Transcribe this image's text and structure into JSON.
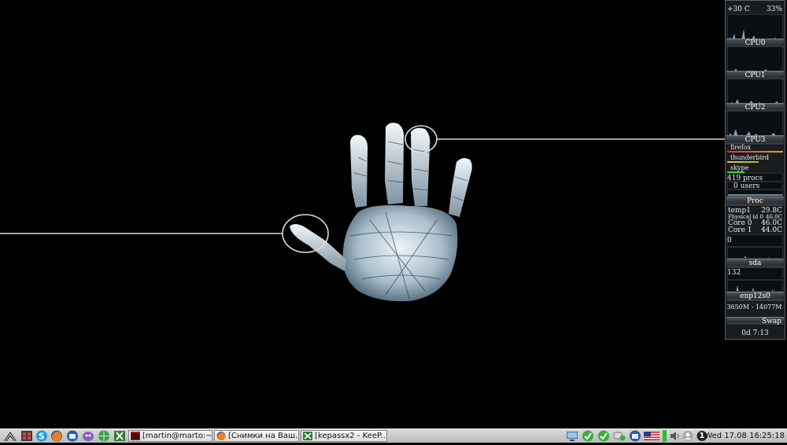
{
  "monitor": {
    "temp_label": "+30 C",
    "temp_percent": "33%",
    "cpus": [
      {
        "label": "CPU0",
        "value": "0%"
      },
      {
        "label": "CPU1",
        "value": "3%"
      },
      {
        "label": "CPU2",
        "value": "4%"
      },
      {
        "label": "CPU3",
        "value": ""
      }
    ],
    "top_procs": [
      {
        "name": "firefox",
        "color": "#e83030"
      },
      {
        "name": "thunderbird",
        "color": "#e8d020"
      },
      {
        "name": "skype",
        "color": "#30d040"
      }
    ],
    "procs_count": "419 procs",
    "users_count": "0 users",
    "proc_label": "Proc",
    "sensors": [
      {
        "name": "temp1",
        "value": "29.8C"
      },
      {
        "name": "Physical id 0",
        "value": "46.0C"
      },
      {
        "name": "Core 0",
        "value": "46.0C"
      },
      {
        "name": "Core 1",
        "value": "44.0C"
      }
    ],
    "disk_value": "0",
    "disk_label": "sda",
    "net_value": "132",
    "net_label": "enp12s0",
    "mem_text": "3650M - 14077M",
    "swap_label": "Swap",
    "uptime": "0d  7:13"
  },
  "taskbar": {
    "tasks": [
      {
        "label": "[martin@marto:~]",
        "icon": "terminal-icon"
      },
      {
        "label": "[Снимки на Ваш...",
        "icon": "firefox-icon"
      },
      {
        "label": "[kepassx2 - KeeP...",
        "icon": "keepassx-icon"
      }
    ],
    "clock": "Wed 17.08 16:25:18",
    "workspace": "1"
  }
}
